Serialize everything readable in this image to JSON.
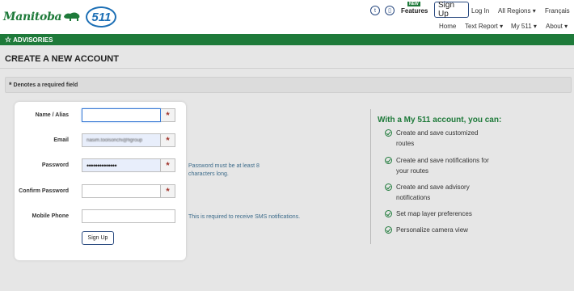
{
  "brand": {
    "logo_text": "Manitoba",
    "badge": "511"
  },
  "top_nav": {
    "features_new": "NEW",
    "features": "Features",
    "sign_up": "Sign Up",
    "log_in": "Log In",
    "all_regions": "All Regions",
    "language": "Français",
    "home": "Home",
    "text_report": "Text Report",
    "my511": "My 511",
    "about": "About"
  },
  "advisories": {
    "label": "ADVISORIES"
  },
  "page": {
    "title": "CREATE A NEW ACCOUNT"
  },
  "required_note": {
    "asterisk": "*",
    "text": "Denotes a required field"
  },
  "form": {
    "fields": [
      {
        "label": "Name / Alias",
        "value": "",
        "required_mark": "*"
      },
      {
        "label": "Email",
        "value": "nasim.toolsonchi@figroup",
        "required_mark": "*"
      },
      {
        "label": "Password",
        "value": "••••••••••••••",
        "required_mark": "*"
      },
      {
        "label": "Confirm Password",
        "value": "",
        "required_mark": "*"
      },
      {
        "label": "Mobile Phone",
        "value": ""
      }
    ],
    "submit": "Sign Up",
    "password_hint_1": "Password must be at least 8",
    "password_hint_2": "characters long.",
    "sms_hint": "This is required to receive SMS notifications."
  },
  "benefits": {
    "title": "With a My 511 account, you can:",
    "items": [
      [
        "Create and save customized",
        "routes"
      ],
      [
        "Create and save notifications for",
        "your routes"
      ],
      [
        "Create and save advisory",
        "notifications"
      ],
      [
        "Set map layer preferences"
      ],
      [
        "Personalize camera view"
      ]
    ]
  },
  "colors": {
    "brand_green": "#1e7a3a",
    "link_blue": "#2a4a80",
    "required_red": "#a0332a"
  }
}
